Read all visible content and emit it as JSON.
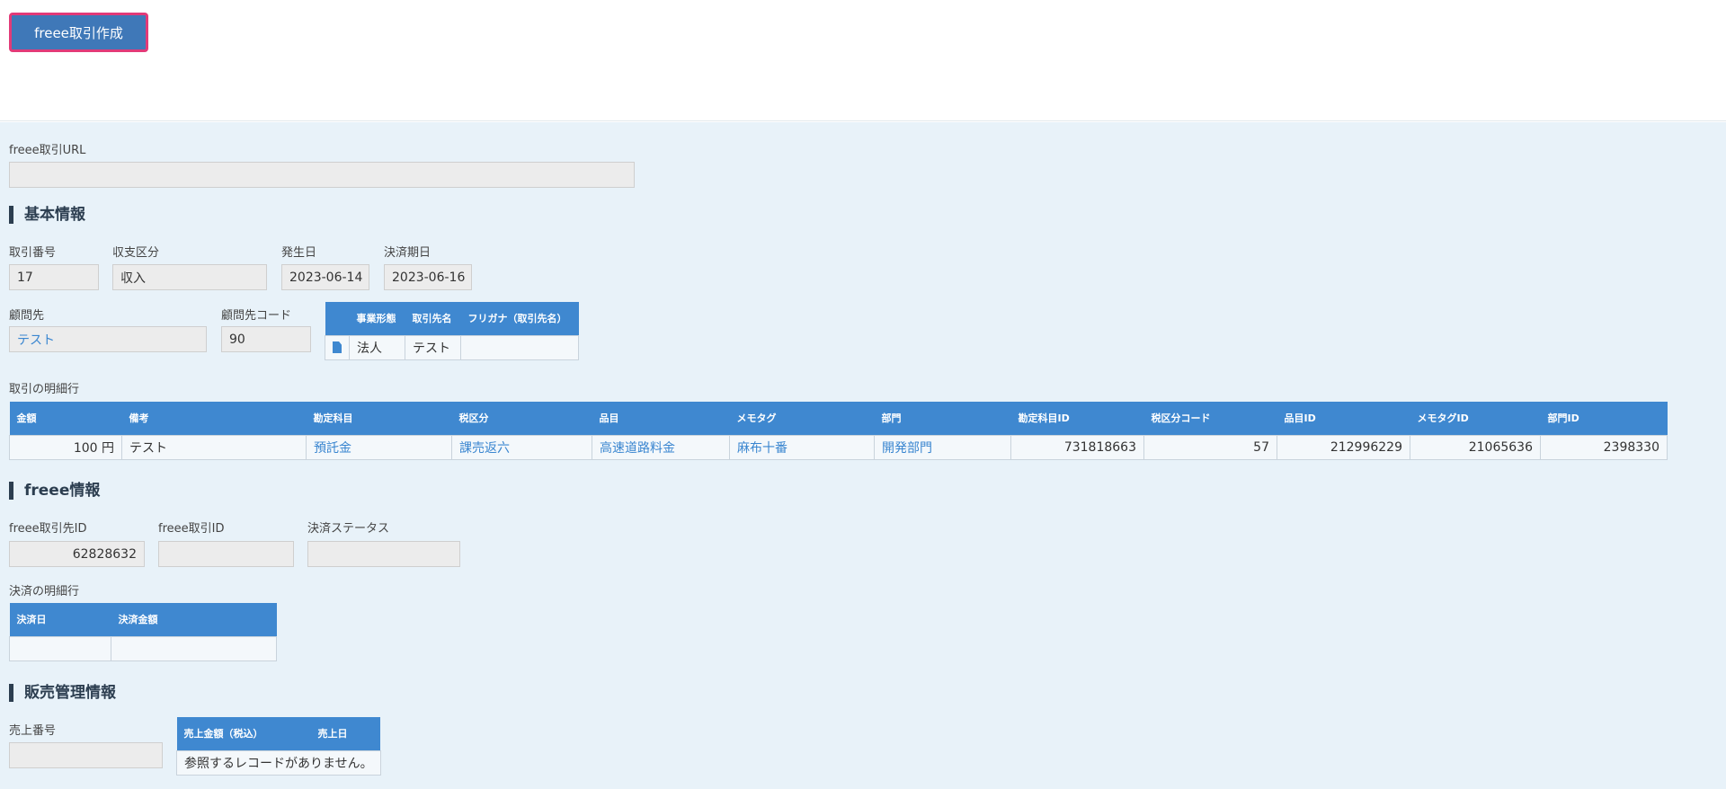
{
  "toolbar": {
    "create_button": "freee取引作成"
  },
  "freee_url": {
    "label": "freee取引URL",
    "value": ""
  },
  "basic": {
    "title": "基本情報",
    "trade_no": {
      "label": "取引番号",
      "value": "17"
    },
    "income_type": {
      "label": "収支区分",
      "value": "収入"
    },
    "issue_date": {
      "label": "発生日",
      "value": "2023-06-14"
    },
    "due_date": {
      "label": "決済期日",
      "value": "2023-06-16"
    },
    "client": {
      "label": "顧問先",
      "value": "テスト"
    },
    "client_code": {
      "label": "顧問先コード",
      "value": "90"
    },
    "partner_table": {
      "headers": [
        "事業形態",
        "取引先名",
        "フリガナ（取引先名）"
      ],
      "rows": [
        {
          "type": "法人",
          "name": "テスト",
          "kana": ""
        }
      ]
    }
  },
  "details": {
    "label": "取引の明細行",
    "headers": [
      "金額",
      "備考",
      "勘定科目",
      "税区分",
      "品目",
      "メモタグ",
      "部門",
      "勘定科目ID",
      "税区分コード",
      "品目ID",
      "メモタグID",
      "部門ID"
    ],
    "rows": [
      {
        "amount": "100 円",
        "note": "テスト",
        "account": "預託金",
        "tax": "課売返六",
        "item": "高速道路料金",
        "memo": "麻布十番",
        "dept": "開発部門",
        "account_id": "731818663",
        "tax_code": "57",
        "item_id": "212996229",
        "memo_id": "21065636",
        "dept_id": "2398330"
      }
    ]
  },
  "freee": {
    "title": "freee情報",
    "partner_id": {
      "label": "freee取引先ID",
      "value": "62828632"
    },
    "deal_id": {
      "label": "freee取引ID",
      "value": ""
    },
    "status": {
      "label": "決済ステータス",
      "value": ""
    },
    "payments": {
      "label": "決済の明細行",
      "headers": [
        "決済日",
        "決済金額"
      ],
      "rows": [
        {
          "date": "",
          "amount": ""
        }
      ]
    }
  },
  "sales": {
    "title": "販売管理情報",
    "sales_no": {
      "label": "売上番号",
      "value": ""
    },
    "table": {
      "headers": [
        "売上金額（税込）",
        "売上日"
      ],
      "empty": "参照するレコードがありません。"
    }
  }
}
